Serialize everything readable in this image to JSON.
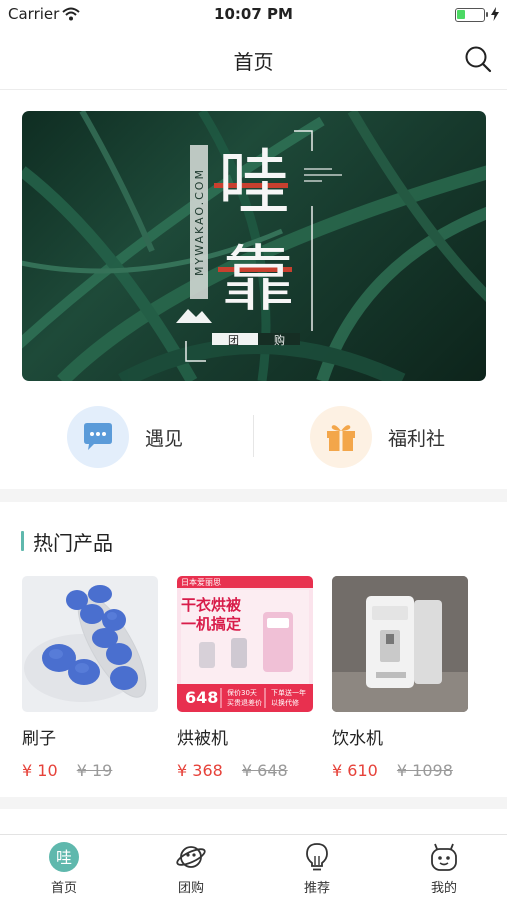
{
  "status_bar": {
    "carrier": "Carrier",
    "time": "10:07 PM",
    "battery_level": 0.3
  },
  "header": {
    "title": "首页"
  },
  "banner": {
    "logo_char_1": "哇",
    "logo_char_2": "靠",
    "side_text": "MYWAKAO.COM",
    "sub_left": "团",
    "sub_right": "购"
  },
  "entries": [
    {
      "label": "遇见",
      "icon": "chat-bubble-icon",
      "color": "#5b9bd9"
    },
    {
      "label": "福利社",
      "icon": "gift-icon",
      "color": "#f3a64a"
    }
  ],
  "hot_products": {
    "title": "热门产品",
    "items": [
      {
        "name": "刷子",
        "price": "¥ 10",
        "original_price": "¥ 19"
      },
      {
        "name": "烘被机",
        "price": "¥ 368",
        "original_price": "¥ 648",
        "image_text": {
          "brand": "日本爱丽思",
          "headline_1": "干衣烘被",
          "headline_2": "一机搞定",
          "price_tag": "648",
          "promo_1": "保价30天",
          "promo_2": "买贵退差价",
          "promo_3": "下单送一年",
          "promo_4": "以换代修"
        }
      },
      {
        "name": "饮水机",
        "price": "¥ 610",
        "original_price": "¥ 1098"
      }
    ]
  },
  "tabbar": [
    {
      "label": "首页",
      "icon": "wa-logo-icon",
      "active": true
    },
    {
      "label": "团购",
      "icon": "planet-icon"
    },
    {
      "label": "推荐",
      "icon": "lightbulb-icon"
    },
    {
      "label": "我的",
      "icon": "robot-face-icon"
    }
  ],
  "colors": {
    "accent": "#5fb8ad",
    "price": "#e6423a",
    "logo_red": "#c8402f"
  }
}
